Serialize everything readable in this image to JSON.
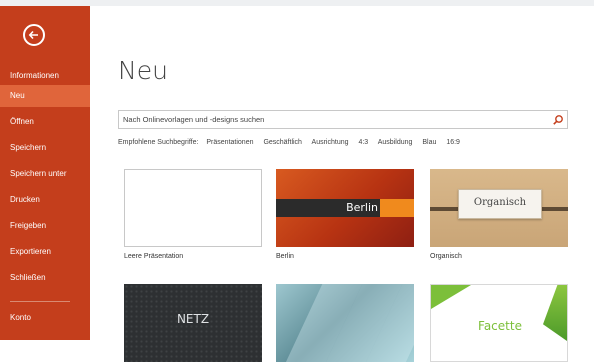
{
  "sidebar": {
    "items": [
      {
        "label": "Informationen",
        "active": false
      },
      {
        "label": "Neu",
        "active": true
      },
      {
        "label": "Öffnen",
        "active": false
      },
      {
        "label": "Speichern",
        "active": false
      },
      {
        "label": "Speichern unter",
        "active": false
      },
      {
        "label": "Drucken",
        "active": false
      },
      {
        "label": "Freigeben",
        "active": false
      },
      {
        "label": "Exportieren",
        "active": false
      },
      {
        "label": "Schließen",
        "active": false
      },
      {
        "label": "Konto",
        "active": false
      }
    ]
  },
  "main": {
    "title": "Neu",
    "search": {
      "placeholder": "Nach Onlinevorlagen und -designs suchen"
    },
    "suggested": {
      "label": "Empfohlene Suchbegriffe:",
      "terms": [
        "Präsentationen",
        "Geschäftlich",
        "Ausrichtung",
        "4:3",
        "Ausbildung",
        "Blau",
        "16:9"
      ]
    },
    "templates": [
      {
        "label": "Leere Präsentation",
        "thumb_text": ""
      },
      {
        "label": "Berlin",
        "thumb_text": "Berlin"
      },
      {
        "label": "Organisch",
        "thumb_text": "Organisch"
      },
      {
        "label": "",
        "thumb_text": "NETZ"
      },
      {
        "label": "",
        "thumb_text": ""
      },
      {
        "label": "",
        "thumb_text": "Facette"
      }
    ]
  },
  "colors": {
    "accent": "#c43e1c",
    "active": "#e0653b"
  }
}
